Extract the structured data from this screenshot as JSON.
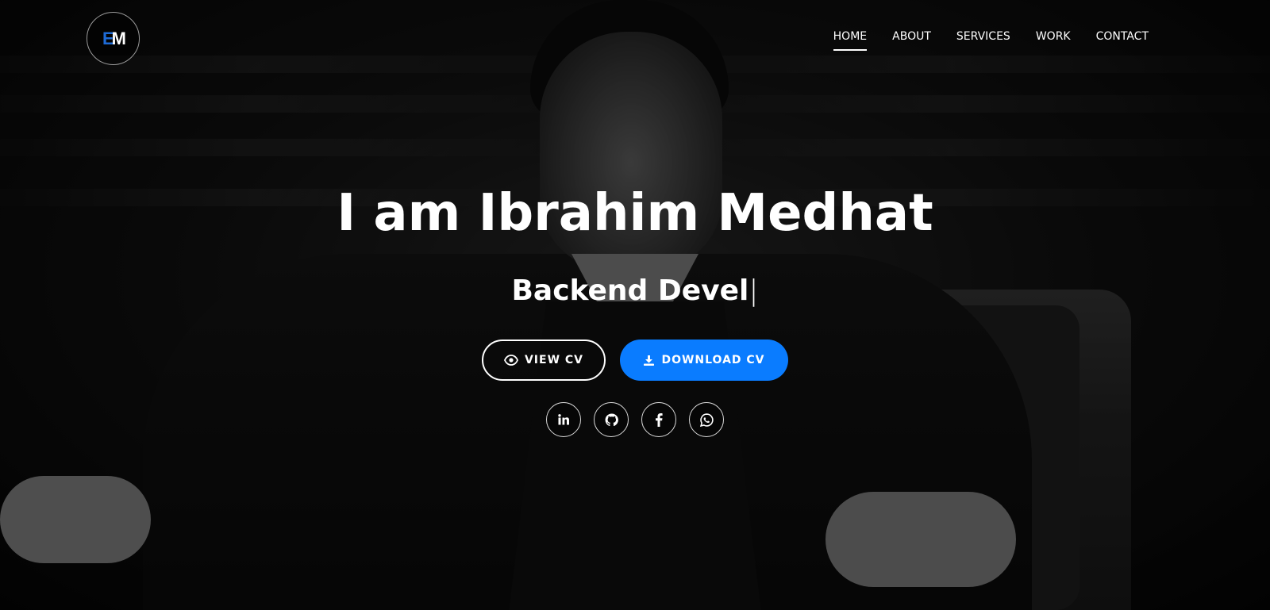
{
  "navbar": {
    "logo_text": "EM",
    "links": [
      "HOME",
      "ABOUT",
      "SERVICES",
      "WORK",
      "CONTACT"
    ],
    "active": "HOME"
  },
  "hero": {
    "title": "I am Ibrahim Medhat",
    "subtitle": "Backend Devel",
    "cursor": "|"
  },
  "buttons": {
    "view_cv": "VIEW CV",
    "download_cv": "DOWNLOAD CV"
  },
  "socials": [
    "linkedin-icon",
    "github-icon",
    "facebook-icon",
    "whatsapp-icon"
  ],
  "colors": {
    "primary": "#0a7cff",
    "logo_accent": "#1e6bd6"
  }
}
